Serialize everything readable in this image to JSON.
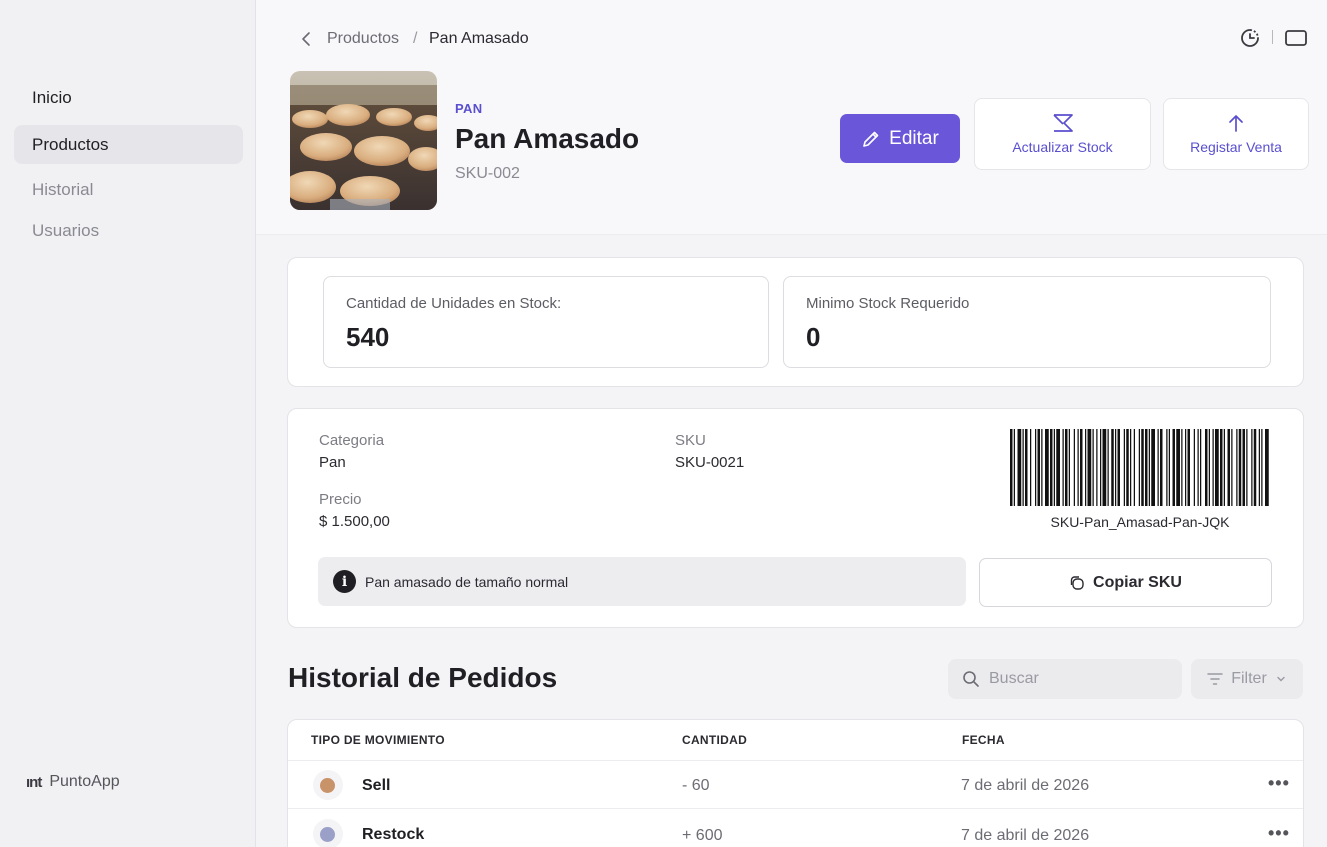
{
  "sidebar": {
    "items": [
      {
        "label": "Inicio"
      },
      {
        "label": "Productos"
      },
      {
        "label": "Historial"
      },
      {
        "label": "Usuarios"
      }
    ],
    "brand": "PuntoApp",
    "brand_logo": "ınt"
  },
  "breadcrumb": {
    "parent": "Productos",
    "separator": "/",
    "current": "Pan Amasado"
  },
  "product": {
    "category_tag": "PAN",
    "title": "Pan Amasado",
    "sku": "SKU-002"
  },
  "actions": {
    "edit": "Editar",
    "update_stock": "Actualizar Stock",
    "register_sale": "Registar Venta"
  },
  "stock": {
    "units_label": "Cantidad de Unidades en Stock:",
    "units_value": "540",
    "min_label": "Minimo Stock Requerido",
    "min_value": "0"
  },
  "details": {
    "category_label": "Categoria",
    "category_value": "Pan",
    "sku_label": "SKU",
    "sku_value": "SKU-0021",
    "price_label": "Precio",
    "price_value": "$ 1.500,00",
    "barcode_text": "SKU-Pan_Amasad-Pan-JQK",
    "description": "Pan amasado de tamaño normal",
    "copy_sku": "Copiar SKU"
  },
  "orders": {
    "title": "Historial de Pedidos",
    "search_placeholder": "Buscar",
    "filter_label": "Filter",
    "columns": [
      "TIPO DE MOVIMIENTO",
      "CANTIDAD",
      "FECHA"
    ],
    "rows": [
      {
        "type": "Sell",
        "quantity": "- 60",
        "date": "7 de abril de 2026",
        "color": "#c9936a"
      },
      {
        "type": "Restock",
        "quantity": "+ 600",
        "date": "7 de abril de 2026",
        "color": "#9aa0c8"
      }
    ],
    "row_menu": "•••"
  },
  "colors": {
    "accent": "#6a56d8",
    "accent_text": "#5a4fcf"
  },
  "icons": [
    "chevron-left-icon",
    "history-icon",
    "panel-icon",
    "pencil-icon",
    "stock-update-icon",
    "arrow-up-icon",
    "info-icon",
    "copy-icon",
    "search-icon",
    "filter-icon",
    "chevron-down-icon",
    "more-icon"
  ]
}
